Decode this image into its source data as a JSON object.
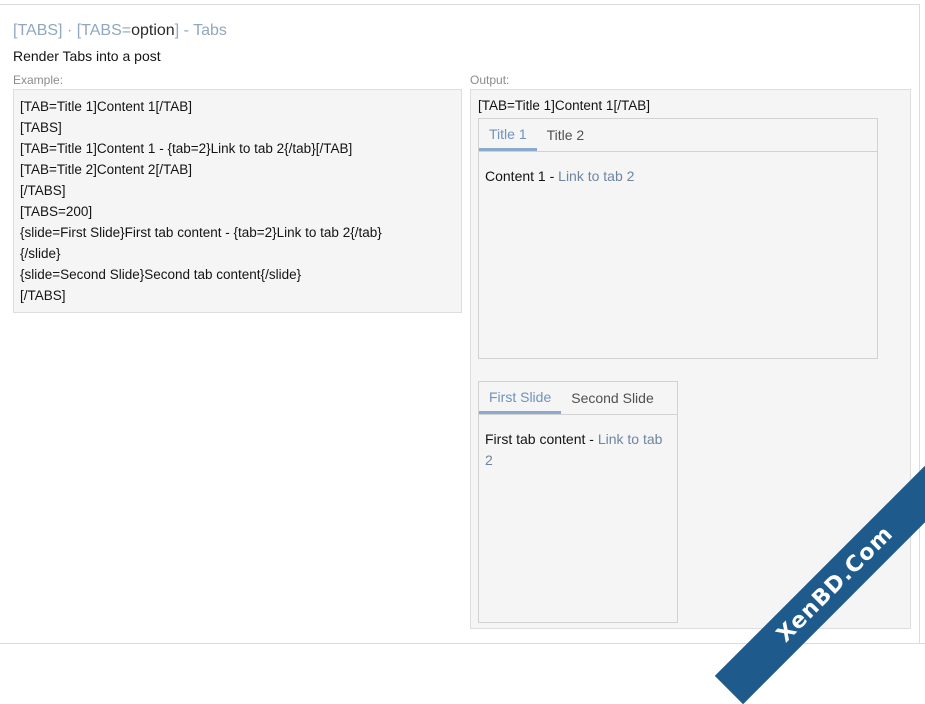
{
  "header": {
    "title_tag": "[TABS]",
    "title_sep": " · ",
    "title_tag2_open": "[TABS=",
    "title_option": "option",
    "title_tag2_close": "]",
    "title_name": " - Tabs",
    "description": "Render Tabs into a post"
  },
  "example": {
    "label": "Example:",
    "lines": [
      "[TAB=Title 1]Content 1[/TAB]",
      "[TABS]",
      "[TAB=Title 1]Content 1 - {tab=2}Link to tab 2{/tab}[/TAB]",
      "[TAB=Title 2]Content 2[/TAB]",
      "[/TABS]",
      "[TABS=200]",
      "{slide=First Slide}First tab content - {tab=2}Link to tab 2{/tab}",
      "{/slide}",
      "{slide=Second Slide}Second tab content{/slide}",
      "[/TABS]"
    ]
  },
  "output": {
    "label": "Output:",
    "raw_line": "[TAB=Title 1]Content 1[/TAB]",
    "tabs_a": {
      "tabs": [
        "Title 1",
        "Title 2"
      ],
      "active": 0,
      "content_text": "Content 1 - ",
      "content_link": "Link to tab 2"
    },
    "tabs_b": {
      "tabs": [
        "First Slide",
        "Second Slide"
      ],
      "active": 0,
      "content_text": "First tab content - ",
      "content_link": "Link to tab 2"
    }
  },
  "watermark": {
    "text": "XenBD.Com",
    "color": "#1e5b8c"
  }
}
